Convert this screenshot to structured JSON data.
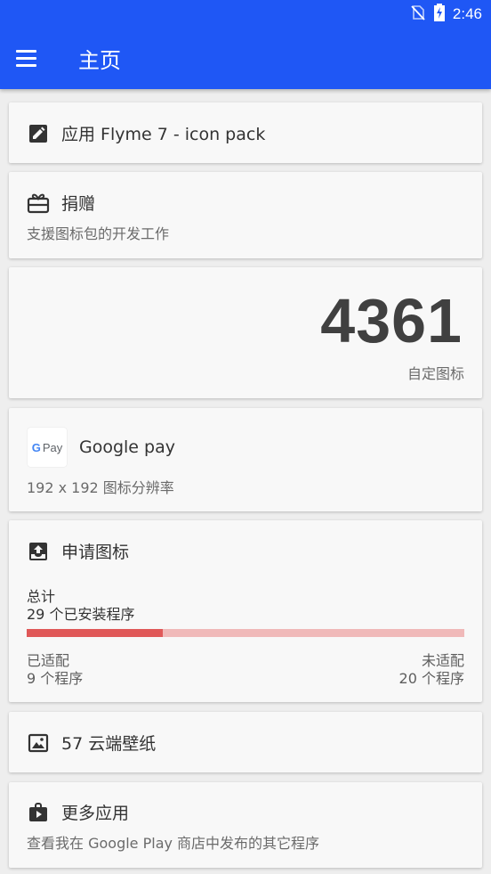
{
  "status_bar": {
    "time": "2:46",
    "icons": [
      "no-sim-icon",
      "battery-charging-icon"
    ]
  },
  "app_bar": {
    "title": "主页",
    "menu_icon": "menu-icon"
  },
  "theme": {
    "accent": "#1f57f5",
    "progress_fill": "#e05858",
    "progress_track": "#f0b9b9"
  },
  "apply_card": {
    "label": "应用 Flyme 7 - icon pack"
  },
  "donate_card": {
    "title": "捐赠",
    "subtitle": "支援图标包的开发工作"
  },
  "icons_card": {
    "count": "4361",
    "label": "自定图标"
  },
  "gpay_card": {
    "logo_text": "Pay",
    "logo_g": "G",
    "title": "Google pay",
    "subtitle": "192 x 192 图标分辨率"
  },
  "request_card": {
    "title": "申请图标",
    "total_label": "总计",
    "installed": "29 个已安装程序",
    "themed_label": "已适配",
    "themed_count": "9 个程序",
    "unthemed_label": "未适配",
    "unthemed_count": "20 个程序",
    "progress_fraction": 0.31
  },
  "wallpaper_card": {
    "label": "57 云端壁纸"
  },
  "more_apps_card": {
    "title": "更多应用",
    "subtitle": "查看我在 Google Play 商店中发布的其它程序"
  }
}
